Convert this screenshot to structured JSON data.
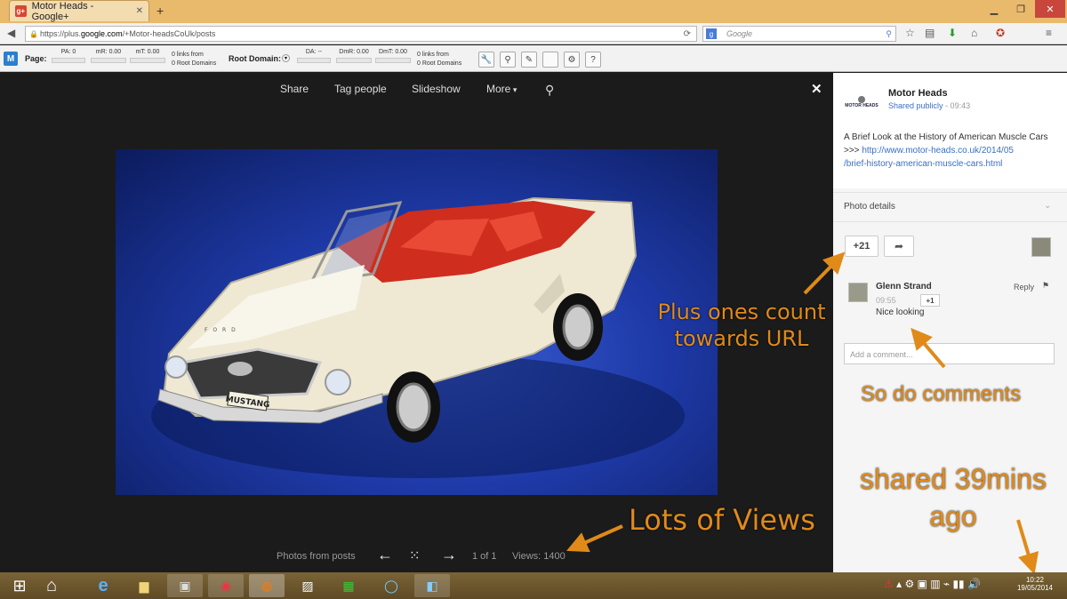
{
  "browser": {
    "tab_title": "Motor Heads - Google+",
    "tab_icon": "g+",
    "url_prefix": "https://plus.",
    "url_domain": "google.com",
    "url_path": "/+Motor-headsCoUk/posts",
    "search_placeholder": "Google",
    "new_tab": "+"
  },
  "mozbar": {
    "page_label": "Page:",
    "pa": "PA: 0",
    "mr": "mR: 0.00",
    "mt": "mT: 0.00",
    "links1": "0 links from",
    "links2": "0 Root Domains",
    "root_label": "Root Domain:",
    "da": "DA: --",
    "dmr": "DmR: 0.00",
    "dmt": "DmT: 0.00",
    "links3": "0 links from",
    "links4": "0 Root Domains"
  },
  "viewer": {
    "share": "Share",
    "tag_people": "Tag people",
    "slideshow": "Slideshow",
    "more": "More",
    "close": "✕",
    "photos_from_posts": "Photos from posts",
    "counter": "1 of 1",
    "views": "Views: 1400",
    "plate": "MUSTANG",
    "hood_badge": "F O R D"
  },
  "post": {
    "author": "Motor Heads",
    "logo_text": "MOTOR HEADS",
    "visibility": "Shared publicly",
    "time": "- 09:43",
    "text": "A Brief Look at the History of American Muscle Cars >>>",
    "link_line1": "http://www.motor-heads.co.uk/2014/05",
    "link_line2": "/brief-history-american-muscle-cars.html",
    "photo_details": "Photo details",
    "plus_count": "+21"
  },
  "comment": {
    "author": "Glenn Strand",
    "time": "09:55",
    "plus": "+1",
    "text": "Nice looking",
    "reply": "Reply",
    "add_placeholder": "Add a comment..."
  },
  "annotations": {
    "plus_ones_1": "Plus ones count",
    "plus_ones_2": "towards URL",
    "comments": "So do comments",
    "shared_1": "shared 39mins",
    "shared_2": "ago",
    "views": "Lots of Views"
  },
  "taskbar": {
    "time": "10:22",
    "date": "19/05/2014"
  }
}
